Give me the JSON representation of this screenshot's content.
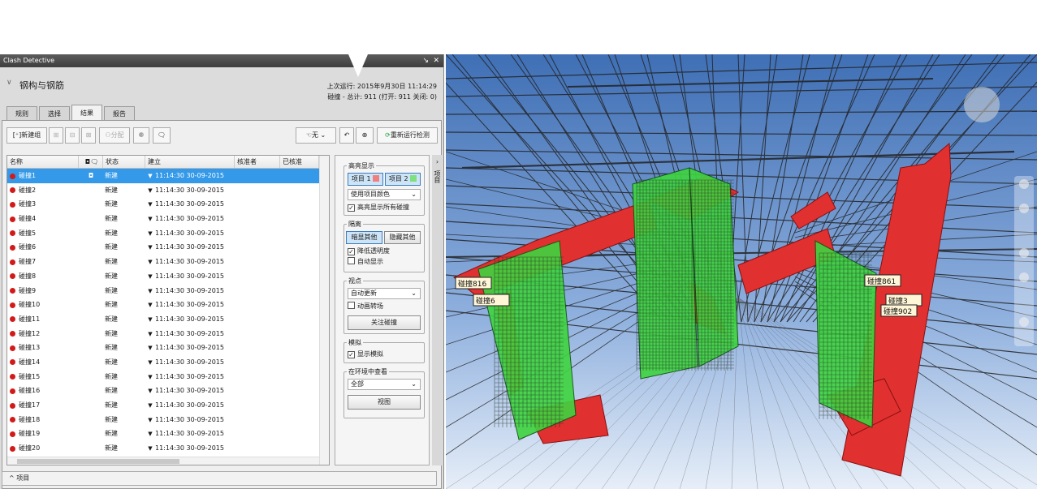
{
  "window": {
    "title": "Clash Detective",
    "controls": "✓ ✕"
  },
  "test": {
    "name": "钢构与钢筋",
    "last_run": "上次运行: 2015年9月30日 11:14:29",
    "summary": "碰撞 - 总计: 911  (打开: 911  关闭: 0)"
  },
  "tabs": [
    "规则",
    "选择",
    "结果",
    "报告"
  ],
  "toolbar": {
    "new_group": "新建组",
    "assign": "分配",
    "none": "无",
    "rerun": "重新运行检测"
  },
  "grid": {
    "headers": [
      "名称",
      "状态",
      "建立",
      "核准者",
      "已核准"
    ],
    "rows": [
      {
        "name": "碰撞1",
        "status": "新建",
        "date": "11:14:30 30-09-2015"
      },
      {
        "name": "碰撞2",
        "status": "新建",
        "date": "11:14:30 30-09-2015"
      },
      {
        "name": "碰撞3",
        "status": "新建",
        "date": "11:14:30 30-09-2015"
      },
      {
        "name": "碰撞4",
        "status": "新建",
        "date": "11:14:30 30-09-2015"
      },
      {
        "name": "碰撞5",
        "status": "新建",
        "date": "11:14:30 30-09-2015"
      },
      {
        "name": "碰撞6",
        "status": "新建",
        "date": "11:14:30 30-09-2015"
      },
      {
        "name": "碰撞7",
        "status": "新建",
        "date": "11:14:30 30-09-2015"
      },
      {
        "name": "碰撞8",
        "status": "新建",
        "date": "11:14:30 30-09-2015"
      },
      {
        "name": "碰撞9",
        "status": "新建",
        "date": "11:14:30 30-09-2015"
      },
      {
        "name": "碰撞10",
        "status": "新建",
        "date": "11:14:30 30-09-2015"
      },
      {
        "name": "碰撞11",
        "status": "新建",
        "date": "11:14:30 30-09-2015"
      },
      {
        "name": "碰撞12",
        "status": "新建",
        "date": "11:14:30 30-09-2015"
      },
      {
        "name": "碰撞13",
        "status": "新建",
        "date": "11:14:30 30-09-2015"
      },
      {
        "name": "碰撞14",
        "status": "新建",
        "date": "11:14:30 30-09-2015"
      },
      {
        "name": "碰撞15",
        "status": "新建",
        "date": "11:14:30 30-09-2015"
      },
      {
        "name": "碰撞16",
        "status": "新建",
        "date": "11:14:30 30-09-2015"
      },
      {
        "name": "碰撞17",
        "status": "新建",
        "date": "11:14:30 30-09-2015"
      },
      {
        "name": "碰撞18",
        "status": "新建",
        "date": "11:14:30 30-09-2015"
      },
      {
        "name": "碰撞19",
        "status": "新建",
        "date": "11:14:30 30-09-2015"
      },
      {
        "name": "碰撞20",
        "status": "新建",
        "date": "11:14:30 30-09-2015"
      }
    ]
  },
  "side": {
    "highlight_title": "高亮显示",
    "item1": "项目 1",
    "item2": "项目 2",
    "color_mode": "使用项目颜色",
    "highlight_all": "高亮显示所有碰撞",
    "isolate_title": "隔离",
    "dim_others": "暗显其他",
    "hide_others": "隐藏其他",
    "reduce_transparency": "降低透明度",
    "auto_reveal": "自动显示",
    "viewpoint_title": "视点",
    "viewpoint_mode": "自动更新",
    "animate": "动画转场",
    "focus_clash": "关注碰撞",
    "simulate_title": "模拟",
    "show_sim": "显示模拟",
    "env_title": "在环境中查看",
    "env_mode": "全部",
    "view_btn": "视图",
    "side_tab": "项目"
  },
  "items_bar": "项目",
  "viewport": {
    "tags_left": [
      "碰撞816",
      "碰撞6"
    ],
    "tags_right": [
      "碰撞861",
      "碰撞3",
      "碰撞902"
    ],
    "colors": {
      "steel": "#e03030",
      "rebar": "#3fd43f",
      "sky": "#5b86c4"
    }
  }
}
